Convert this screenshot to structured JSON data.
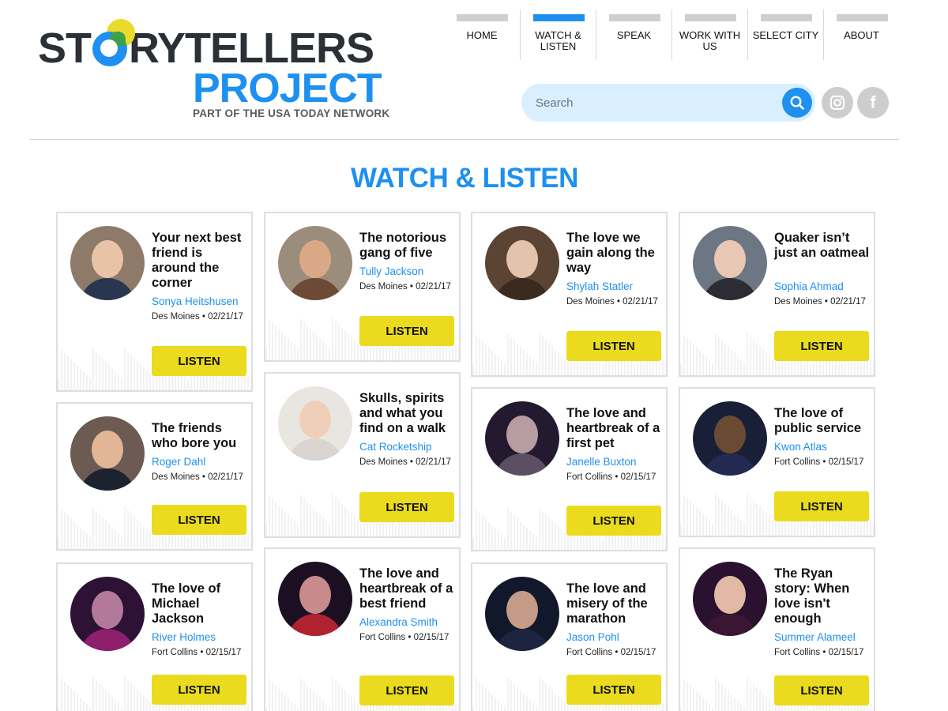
{
  "logo": {
    "top_pre": "ST",
    "top_post": "RYTELLERS",
    "bottom": "PROJECT",
    "sub": "PART OF THE USA TODAY NETWORK"
  },
  "nav": [
    {
      "label": "HOME",
      "active": false
    },
    {
      "label": "WATCH & LISTEN",
      "active": true
    },
    {
      "label": "SPEAK",
      "active": false
    },
    {
      "label": "WORK WITH US",
      "active": false
    },
    {
      "label": "SELECT CITY",
      "active": false
    },
    {
      "label": "ABOUT",
      "active": false
    }
  ],
  "search": {
    "placeholder": "Search"
  },
  "social": [
    {
      "icon": "instagram-icon"
    },
    {
      "icon": "facebook-icon"
    }
  ],
  "page_title": "WATCH & LISTEN",
  "colors": {
    "accent": "#1e90ef",
    "button": "#eadb1e",
    "card_border": "#dedede",
    "search_bg": "#d9efff"
  },
  "cards": [
    {
      "title": "Your next best friend is around the corner",
      "author": "Sonya Heitshusen",
      "city": "Des Moines",
      "date": "02/21/17",
      "button": "LISTEN"
    },
    {
      "title": "The friends who bore you",
      "author": "Roger Dahl",
      "city": "Des Moines",
      "date": "02/21/17",
      "button": "LISTEN"
    },
    {
      "title": "The love of Michael Jackson",
      "author": "River Holmes",
      "city": "Fort Collins",
      "date": "02/15/17",
      "button": "LISTEN"
    },
    {
      "title": "The notorious gang of five",
      "author": "Tully Jackson",
      "city": "Des Moines",
      "date": "02/21/17",
      "button": "LISTEN"
    },
    {
      "title": "Skulls, spirits and what you find on a walk",
      "author": "Cat Rocketship",
      "city": "Des Moines",
      "date": "02/21/17",
      "button": "LISTEN"
    },
    {
      "title": "The love and heartbreak of a best friend",
      "author": "Alexandra Smith",
      "city": "Fort Collins",
      "date": "02/15/17",
      "button": "LISTEN"
    },
    {
      "title": "The love we gain along the way",
      "author": "Shylah Statler",
      "city": "Des Moines",
      "date": "02/21/17",
      "button": "LISTEN"
    },
    {
      "title": "The love and heartbreak of a first pet",
      "author": "Janelle Buxton",
      "city": "Fort Collins",
      "date": "02/15/17",
      "button": "LISTEN"
    },
    {
      "title": "The love and misery of the marathon",
      "author": "Jason Pohl",
      "city": "Fort Collins",
      "date": "02/15/17",
      "button": "LISTEN"
    },
    {
      "title": "Quaker isn’t just an oatmeal",
      "author": "Sophia Ahmad",
      "city": "Des Moines",
      "date": "02/21/17",
      "button": "LISTEN"
    },
    {
      "title": "The love of public service",
      "author": "Kwon Atlas",
      "city": "Fort Collins",
      "date": "02/15/17",
      "button": "LISTEN"
    },
    {
      "title": "The Ryan story: When love isn't enough",
      "author": "Summer Alameel",
      "city": "Fort Collins",
      "date": "02/15/17",
      "button": "LISTEN"
    }
  ]
}
